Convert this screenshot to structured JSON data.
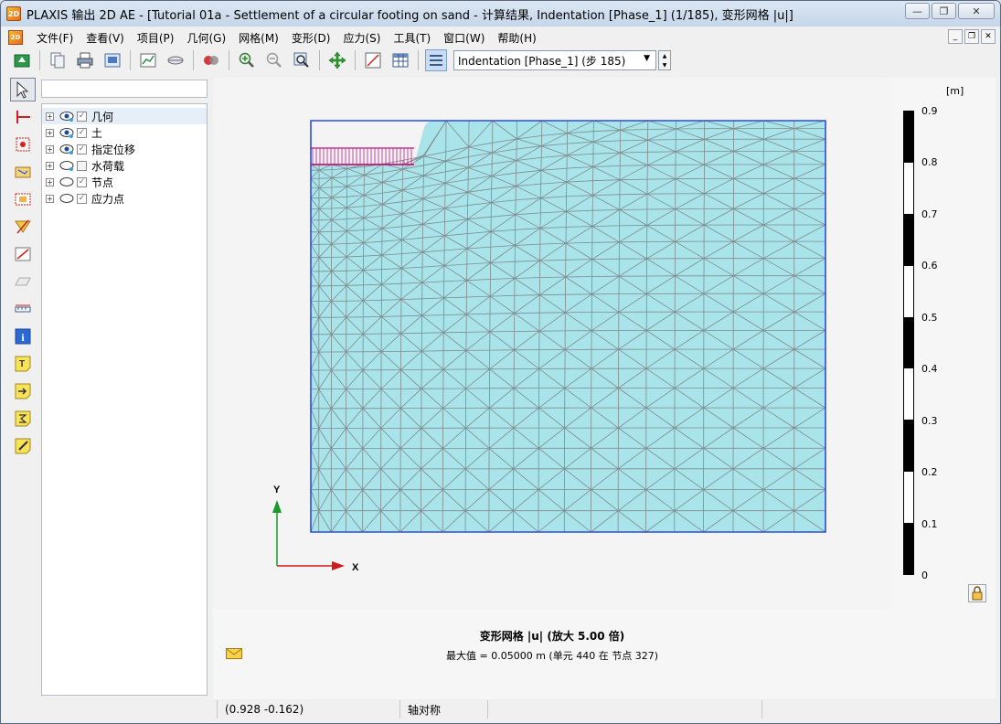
{
  "window": {
    "title": "PLAXIS 输出 2D AE - [Tutorial 01a - Settlement of a circular footing on sand - 计算结果, Indentation [Phase_1] (1/185), 变形网格 |u|]",
    "app_icon_text": "2D"
  },
  "menu": [
    {
      "label": "文件(F)"
    },
    {
      "label": "查看(V)"
    },
    {
      "label": "项目(P)"
    },
    {
      "label": "几何(G)"
    },
    {
      "label": "网格(M)"
    },
    {
      "label": "变形(D)"
    },
    {
      "label": "应力(S)"
    },
    {
      "label": "工具(T)"
    },
    {
      "label": "窗口(W)"
    },
    {
      "label": "帮助(H)"
    }
  ],
  "toolbar": {
    "phase_select_value": "Indentation [Phase_1] (步 185)",
    "icons": [
      "open-project-icon",
      "copy-icon",
      "print-icon",
      "export-icon",
      "curves-icon",
      "cross-section-icon",
      "view-icon",
      "zoom-in-icon",
      "zoom-out-icon",
      "zoom-window-icon",
      "pan-icon",
      "scale-icon",
      "table-icon",
      "phase-list-icon"
    ]
  },
  "left_tools": [
    "select-icon",
    "cross-section-line-icon",
    "select-point-icon",
    "hint-box-icon",
    "node-select-icon",
    "probe-icon",
    "distance-icon",
    "scale-icon",
    "ruler-icon",
    "info-icon",
    "text-note-icon",
    "arrow-note-icon",
    "formula-note-icon",
    "edit-note-icon"
  ],
  "tree": {
    "search_value": "",
    "items": [
      {
        "label": "几何",
        "visible": true,
        "checked": true,
        "selected": true
      },
      {
        "label": "土",
        "visible": true,
        "checked": true,
        "selected": false
      },
      {
        "label": "指定位移",
        "visible": true,
        "checked": true,
        "selected": false
      },
      {
        "label": "水荷载",
        "visible": false,
        "checked": false,
        "selected": false
      },
      {
        "label": "节点",
        "visible": false,
        "checked": true,
        "selected": false
      },
      {
        "label": "应力点",
        "visible": false,
        "checked": true,
        "selected": false
      }
    ]
  },
  "plot": {
    "axis_x_label": "X",
    "axis_y_label": "Y",
    "colors": {
      "mesh_fill": "#a9e4ea",
      "mesh_line": "#7e8c8e",
      "boundary": "#2a4fd6",
      "load": "#c0187d"
    }
  },
  "legend": {
    "unit": "[m]",
    "ticks": [
      "0.9",
      "0.8",
      "0.7",
      "0.6",
      "0.5",
      "0.4",
      "0.3",
      "0.2",
      "0.1",
      "0"
    ]
  },
  "caption": {
    "title": "变形网格 |u| (放大 5.00 倍)",
    "subtitle": "最大值 = 0.05000 m (单元 440 在 节点 327)"
  },
  "status": {
    "empty": "",
    "coords": "(0.928 -0.162)",
    "mode": "轴对称"
  }
}
